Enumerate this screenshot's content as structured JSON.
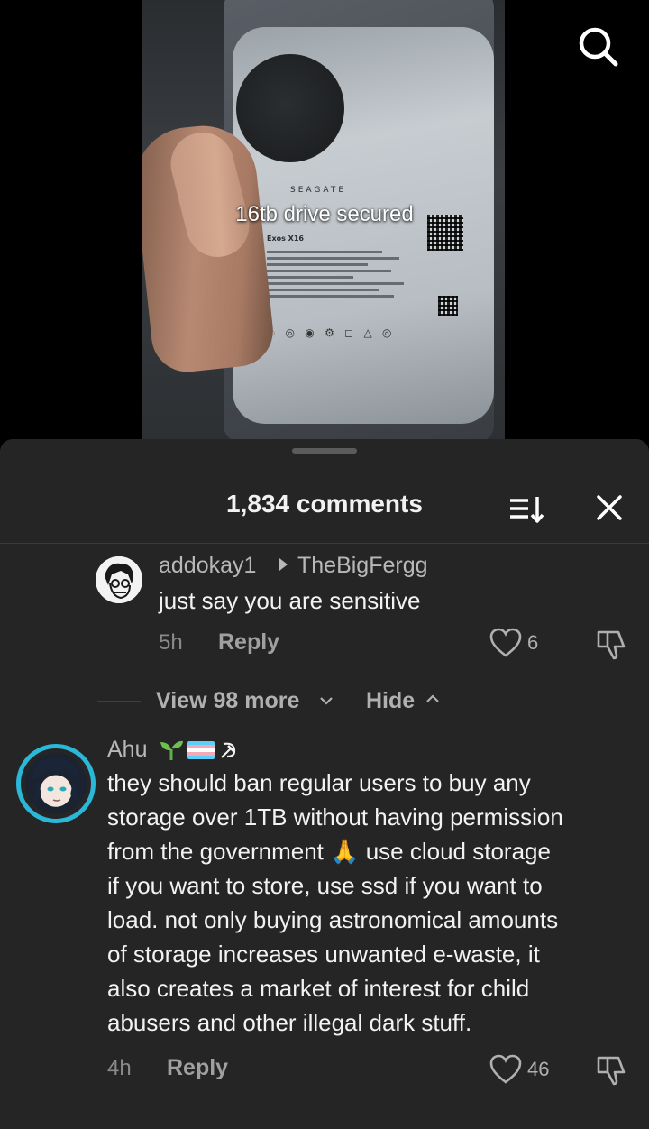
{
  "video": {
    "caption": "16tb drive secured",
    "label_brand": "SEAGATE",
    "label_model": "Exos X16"
  },
  "comments_sheet": {
    "count_label": "1,834 comments",
    "reply_comment": {
      "username": "addokay1",
      "reply_to": "TheBigFergg",
      "text": "just say you are sensitive",
      "time": "5h",
      "reply_label": "Reply",
      "likes": "6"
    },
    "view_more_label": "View 98 more",
    "hide_label": "Hide",
    "main_comment": {
      "username": "Ahu",
      "text_lines": [
        "they should ban regular users to buy any",
        "storage over 1TB without having permission",
        "from the government 🙏 use cloud storage",
        "if you want to store, use ssd if you want to",
        "load. not only buying astronomical amounts",
        "of storage increases unwanted e-waste, it",
        "also creates a market of interest for child",
        "abusers and other illegal dark stuff."
      ],
      "time": "4h",
      "reply_label": "Reply",
      "likes": "46"
    }
  },
  "colors": {
    "sheet_background": "#252525",
    "avatar_ring": "#2bb7d8",
    "primary_text": "#f2f2f2",
    "secondary_text": "#b8b8b8"
  },
  "icons": [
    "search-icon",
    "sort-icon",
    "close-icon",
    "heart-icon",
    "dislike-icon",
    "chevron-down-icon",
    "chevron-up-icon",
    "arrow-right-icon",
    "seedling-icon",
    "trans-flag-icon",
    "hammer-sickle-icon"
  ]
}
